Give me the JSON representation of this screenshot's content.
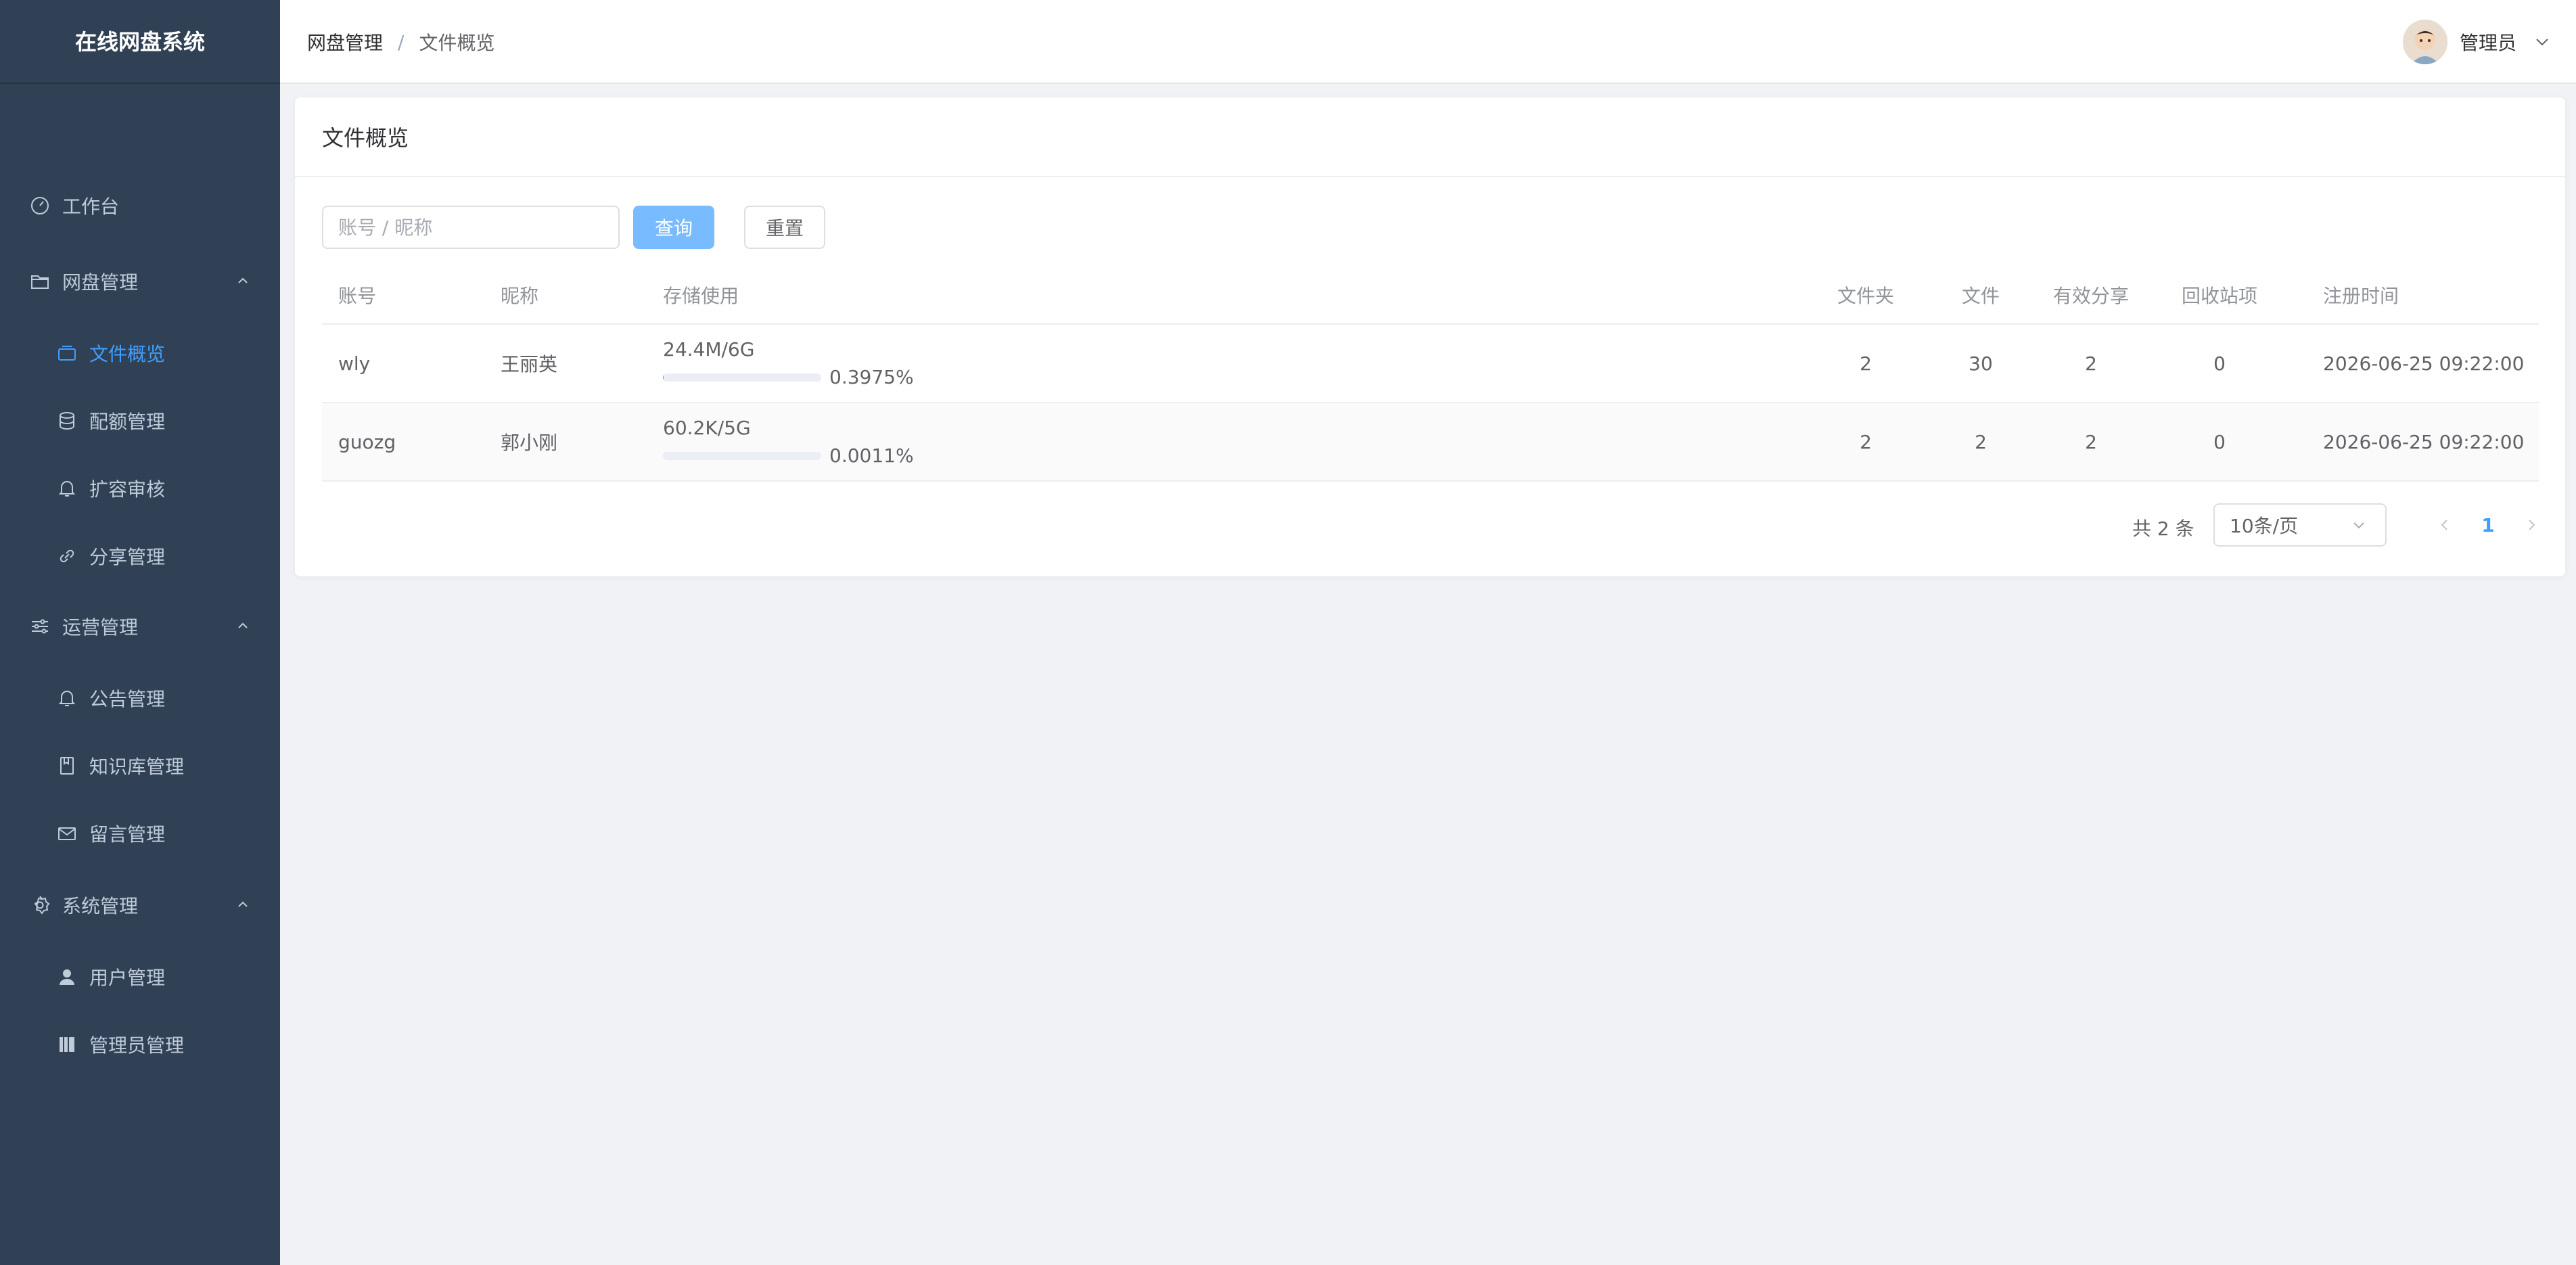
{
  "app": {
    "title": "在线网盘系统"
  },
  "sidebar": {
    "items": [
      {
        "label": "工作台",
        "icon": "dashboard-icon"
      },
      {
        "label": "网盘管理",
        "icon": "folder-icon"
      },
      {
        "label": "文件概览",
        "icon": "files-icon"
      },
      {
        "label": "配额管理",
        "icon": "database-icon"
      },
      {
        "label": "扩容审核",
        "icon": "bell-icon"
      },
      {
        "label": "分享管理",
        "icon": "link-icon"
      },
      {
        "label": "运营管理",
        "icon": "sliders-icon"
      },
      {
        "label": "公告管理",
        "icon": "bell-icon"
      },
      {
        "label": "知识库管理",
        "icon": "book-icon"
      },
      {
        "label": "留言管理",
        "icon": "mail-icon"
      },
      {
        "label": "系统管理",
        "icon": "gear-icon"
      },
      {
        "label": "用户管理",
        "icon": "user-icon"
      },
      {
        "label": "管理员管理",
        "icon": "admin-icon"
      }
    ],
    "active": "文件概览"
  },
  "header": {
    "breadcrumb": [
      "网盘管理",
      "文件概览"
    ],
    "separator": "/",
    "user": "管理员"
  },
  "main": {
    "card_title": "文件概览",
    "search": {
      "placeholder": "账号 / 昵称",
      "value": ""
    },
    "query_label": "查询",
    "reset_label": "重置",
    "table": {
      "columns": [
        "账号",
        "昵称",
        "存储使用",
        "文件夹",
        "文件",
        "有效分享",
        "回收站项",
        "注册时间"
      ],
      "rows": [
        {
          "account": "wly",
          "nickname": "王丽英",
          "storage": "24.4M/6G",
          "percent": "0.3975%",
          "usage_fraction": 0.003975,
          "folders": "2",
          "files": "30",
          "shares": "2",
          "recycle": "0",
          "registered": "2026-06-25 09:22:00"
        },
        {
          "account": "guozg",
          "nickname": "郭小刚",
          "storage": "60.2K/5G",
          "percent": "0.0011%",
          "usage_fraction": 1.1e-05,
          "folders": "2",
          "files": "2",
          "shares": "2",
          "recycle": "0",
          "registered": "2026-06-25 09:22:00"
        }
      ]
    },
    "pagination": {
      "total": "共 2 条",
      "page_size": "10条/页",
      "current_page": "1"
    }
  },
  "colors": {
    "sidebar_bg": "#304156",
    "sidebar_text": "#bfcbd9",
    "accent": "#409eff",
    "page_bg": "#f0f2f5"
  }
}
